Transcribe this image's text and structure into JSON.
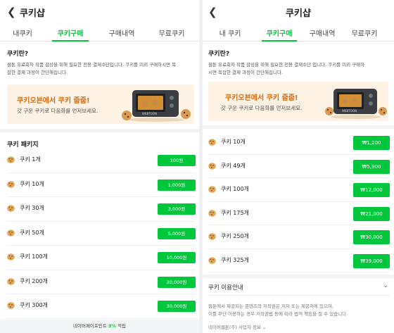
{
  "left": {
    "title": "쿠키샵",
    "tabs": [
      "내쿠키",
      "쿠키구매",
      "구매내역",
      "무료쿠키"
    ],
    "info_title": "쿠키란?",
    "info_desc_1": "웹툰 유료회차 작품 감상을 위해 필요한 전용 결제수단입니다. 쿠키를 미리 구매하시면 복",
    "info_desc_2": "잡한 결제 과정이 간단해집니다.",
    "banner_title": "쿠키오븐에서 쿠키 줍줍!",
    "banner_sub": "갓 구운 쿠키로 다음화를 먼저보세요.",
    "oven_label": "WEBTOON",
    "package_title": "쿠키 패키지",
    "packages": [
      {
        "label": "쿠키 1개",
        "price": "100원"
      },
      {
        "label": "쿠키 10개",
        "price": "1,000원"
      },
      {
        "label": "쿠키 30개",
        "price": "3,000원"
      },
      {
        "label": "쿠키 50개",
        "price": "5,000원"
      },
      {
        "label": "쿠키 100개",
        "price": "10,000원"
      },
      {
        "label": "쿠키 200개",
        "price": "20,000원"
      },
      {
        "label": "쿠키 300개",
        "price": "30,000원"
      }
    ],
    "footer_prefix": "네이버페이포인트 ",
    "footer_pct": "3%",
    "footer_suffix": " 적립"
  },
  "right": {
    "title": "쿠키샵",
    "tabs": [
      "내 쿠키",
      "쿠키구매",
      "구매내역",
      "무료쿠키"
    ],
    "info_title": "쿠키란?",
    "info_desc_1": "웹툰 유료회차 작품 감상을 위해 필요한 전용 결제수단 입니다. 쿠키를 미리 구매하",
    "info_desc_2": "시면 복잡한 결제 과정이 간단해집니다.",
    "banner_title": "쿠키오븐에서 쿠키 줍줍!",
    "banner_sub": "갓 구운 쿠키로 다음화를 먼저보세요.",
    "oven_label": "WEBTOON",
    "packages": [
      {
        "label": "쿠키 10개",
        "price": "₩1,200"
      },
      {
        "label": "쿠키 49개",
        "price": "₩5,900"
      },
      {
        "label": "쿠키 100개",
        "price": "₩12,000"
      },
      {
        "label": "쿠키 175개",
        "price": "₩21,000"
      },
      {
        "label": "쿠키 250개",
        "price": "₩30,000"
      },
      {
        "label": "쿠키 325개",
        "price": "₩39,000"
      }
    ],
    "guide_label": "쿠키 이용안내",
    "legal_1": "웹툰에서 제공되는 콘텐츠의 저작권은 저자 또는 제공처에 있으며,",
    "legal_2": "이를 무단 이용하는 경우 저작권법 등에 따라 법적 책임을 질 수 있습니다.",
    "company": "네이버웹툰(주) 사업자 정보 ⌄"
  },
  "colors": {
    "accent_green": "#00c73c",
    "banner_bg": "#fdf2e4",
    "banner_title": "#d46b14"
  },
  "icons": {
    "back": "chevron-left-icon",
    "cookie": "cookie-icon",
    "guide": "chevron-down-icon"
  }
}
